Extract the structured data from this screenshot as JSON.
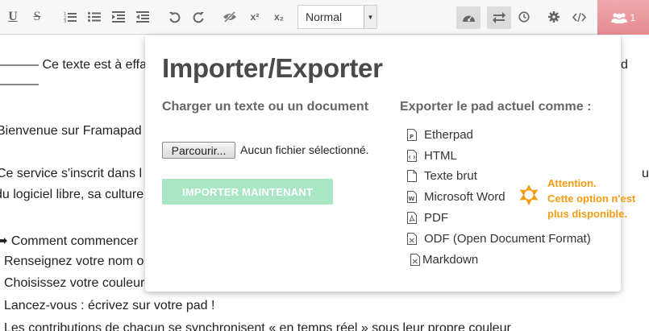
{
  "toolbar": {
    "underline_label": "U",
    "strike_label": "S",
    "superscript_label": "x²",
    "subscript_label": "x₂",
    "heading_select": {
      "selected": "Normal"
    },
    "users_count": "1"
  },
  "pad": {
    "lines": [
      "——— Ce texte est à effac",
      "d",
      "———",
      "Bienvenue sur Framapad",
      "Ce service s'inscrit dans l",
      "u",
      "du logiciel libre, sa culture",
      "➡ Comment commencer",
      "Renseignez votre nom o",
      "Choisissez votre couleur",
      "Lancez-vous : écrivez sur votre pad !",
      "Les contributions de chacun se synchronisent « en temps réel » sous leur propre couleur"
    ]
  },
  "popup": {
    "title": "Importer/Exporter",
    "import": {
      "heading": "Charger un texte ou un document",
      "browse_label": "Parcourir...",
      "file_status": "Aucun fichier sélectionné.",
      "import_button": "IMPORTER MAINTENANT"
    },
    "export": {
      "heading": "Exporter le pad actuel comme :",
      "items": [
        {
          "label": "Etherpad",
          "icon": "etherpad-file-icon"
        },
        {
          "label": "HTML",
          "icon": "html-file-icon"
        },
        {
          "label": "Texte brut",
          "icon": "text-file-icon"
        },
        {
          "label": "Microsoft Word",
          "icon": "word-file-icon"
        },
        {
          "label": "PDF",
          "icon": "pdf-file-icon"
        },
        {
          "label": "ODF (Open Document Format)",
          "icon": "odf-file-icon"
        },
        {
          "label": "Markdown",
          "icon": "markdown-file-icon"
        }
      ]
    }
  },
  "annotation": {
    "line1": "Attention.",
    "line2": "Cette option n'est",
    "line3": "plus disponible.",
    "color": "#f39c12"
  }
}
